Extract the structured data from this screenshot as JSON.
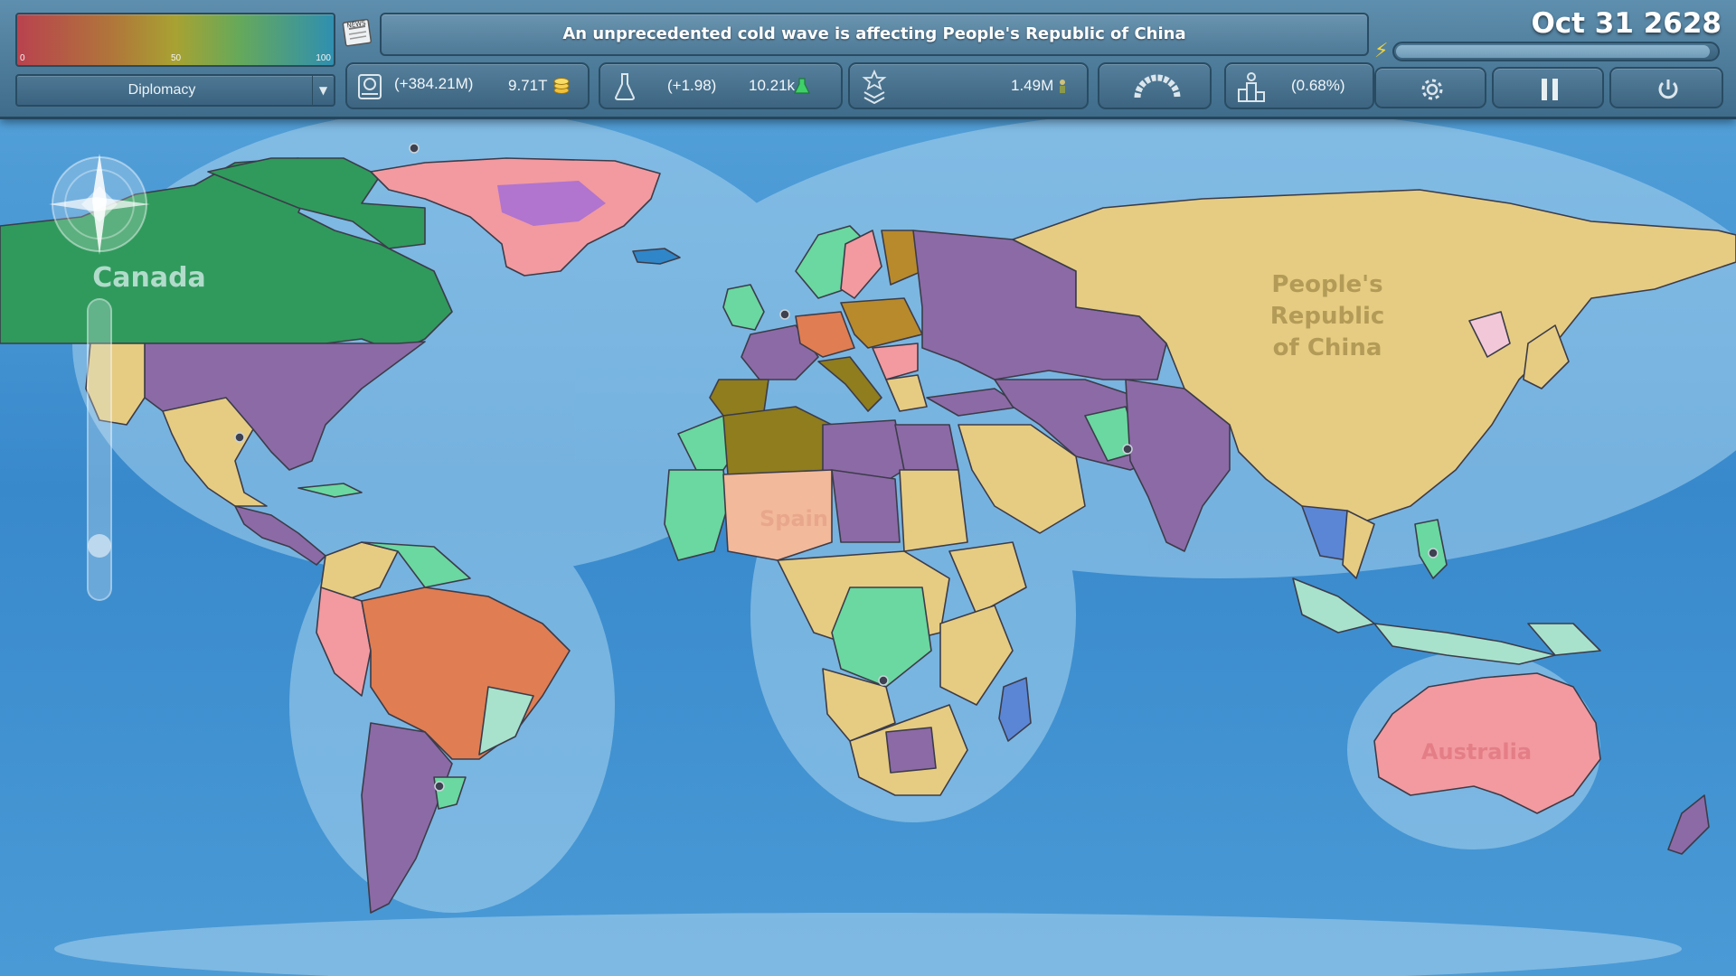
{
  "legend": {
    "min": "0",
    "mid": "50",
    "max": "100"
  },
  "map_mode": {
    "selected": "Diplomacy"
  },
  "news": {
    "icon_label": "NEWS",
    "headline": "An unprecedented cold wave is affecting People's Republic of China"
  },
  "date": "Oct 31 2628",
  "game_speed": 0.98,
  "stats": {
    "money_delta": "(+384.21M)",
    "money_total": "9.71T",
    "research_delta": "(+1.98)",
    "research_total": "10.21k",
    "military_total": "1.49M",
    "growth": "(0.68%)"
  },
  "selected_country": "Canada",
  "zoom_level": 0.15,
  "map_labels": {
    "china_line1": "People's",
    "china_line2": "Republic",
    "china_line3": "of China",
    "spain": "Spain",
    "australia": "Australia"
  },
  "colors": {
    "ocean": "#3b8fd0",
    "player_green": "#2f9a5c",
    "china_yellow": "#e6cc82",
    "purple": "#8c6aa6",
    "olive": "#8f7d1e",
    "orange": "#e07d52",
    "pink": "#f29aa0",
    "mint": "#6ad8a0",
    "peach": "#f2b99a"
  }
}
